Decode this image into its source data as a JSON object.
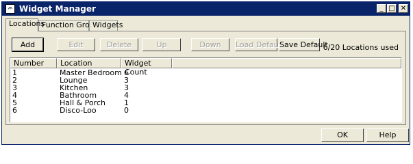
{
  "window": {
    "title": "Widget Manager",
    "app_icon_glyph": "𝄐"
  },
  "titlebar_buttons": {
    "minimize": "_",
    "maximize": "□",
    "close": "✕"
  },
  "tabs": [
    {
      "label": "Locations",
      "active": true
    },
    {
      "label": "Function Groups",
      "active": false
    },
    {
      "label": "Widgets",
      "active": false
    }
  ],
  "toolbar": {
    "add": "Add",
    "edit": "Edit",
    "delete": "Delete",
    "up": "Up",
    "down": "Down",
    "load_default": "Load Default",
    "save_default": "Save Default"
  },
  "status": "6/20 Locations used",
  "table": {
    "columns": [
      "Number",
      "Location",
      "Widget Count"
    ],
    "sort_indicator": "△",
    "rows": [
      [
        "1",
        "Master Bedroom",
        "6"
      ],
      [
        "2",
        "Lounge",
        "3"
      ],
      [
        "3",
        "Kitchen",
        "3"
      ],
      [
        "4",
        "Bathroom",
        "4"
      ],
      [
        "5",
        "Hall & Porch",
        "1"
      ],
      [
        "6",
        "Disco-Loo",
        "0"
      ]
    ]
  },
  "footer": {
    "ok": "OK",
    "help": "Help"
  }
}
